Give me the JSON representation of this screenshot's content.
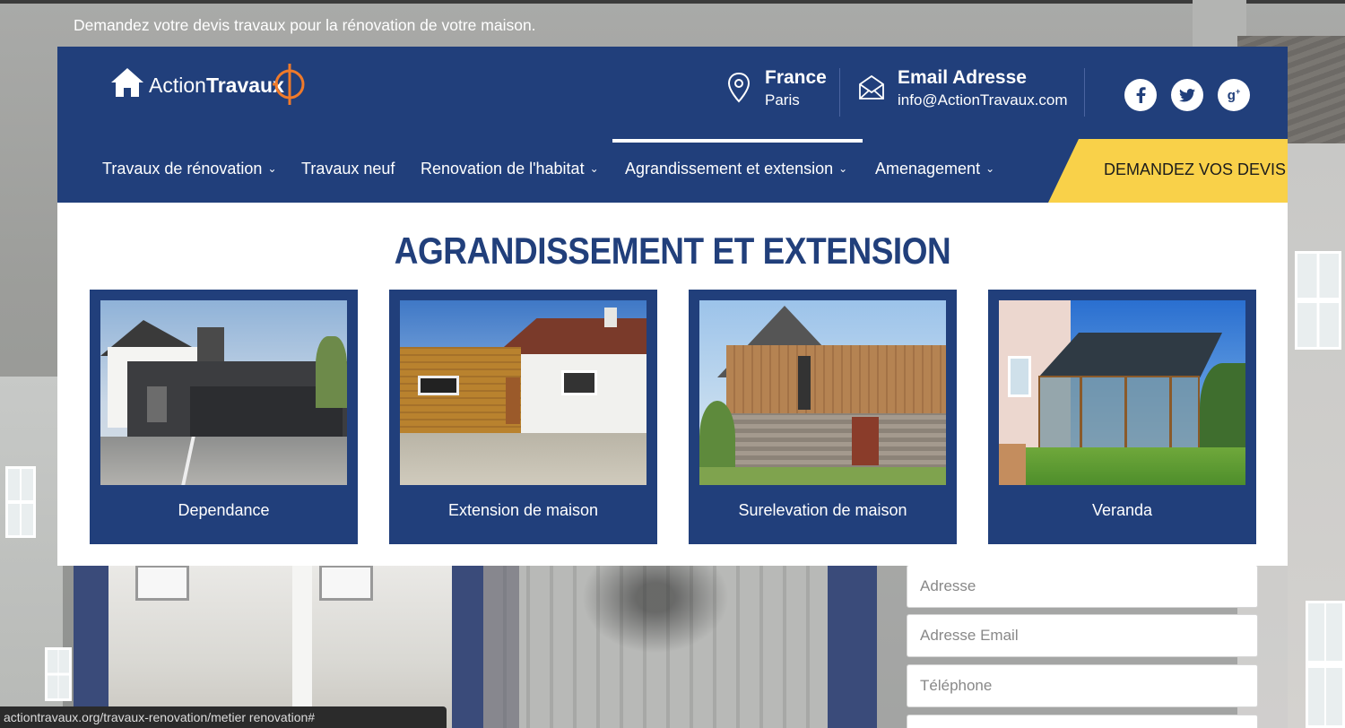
{
  "topbar": {
    "tagline": "Demandez votre devis travaux pour la rénovation de votre maison."
  },
  "header": {
    "logo": {
      "word1": "Action",
      "word2": "Travaux"
    },
    "location": {
      "title": "France",
      "subtitle": "Paris",
      "icon": "map-pin-icon"
    },
    "email": {
      "title": "Email Adresse",
      "address": "info@ActionTravaux.com",
      "icon": "envelope-icon"
    },
    "social": [
      {
        "name": "facebook",
        "glyph": "f"
      },
      {
        "name": "twitter",
        "glyph": "t"
      },
      {
        "name": "google-plus",
        "glyph": "g+"
      }
    ]
  },
  "nav": {
    "items": [
      {
        "label": "Travaux de rénovation",
        "has_dropdown": true
      },
      {
        "label": "Travaux neuf",
        "has_dropdown": false
      },
      {
        "label": "Renovation de l'habitat",
        "has_dropdown": true
      },
      {
        "label": "Agrandissement et extension",
        "has_dropdown": true,
        "active": true
      },
      {
        "label": "Amenagement",
        "has_dropdown": true
      }
    ],
    "cta_label": "DEMANDEZ VOS DEVIS"
  },
  "mega_menu": {
    "title": "AGRANDISSEMENT ET EXTENSION",
    "cards": [
      {
        "label": "Dependance"
      },
      {
        "label": "Extension de maison"
      },
      {
        "label": "Surelevation de maison"
      },
      {
        "label": "Veranda"
      }
    ]
  },
  "form": {
    "address_placeholder": "Adresse",
    "email_placeholder": "Adresse Email",
    "phone_placeholder": "Téléphone"
  },
  "status_bar": {
    "url": "actiontravaux.org/travaux-renovation/metier renovation#"
  },
  "colors": {
    "brand_blue": "#213f7b",
    "cta_yellow": "#f9d149",
    "logo_orange": "#f07a2a"
  }
}
